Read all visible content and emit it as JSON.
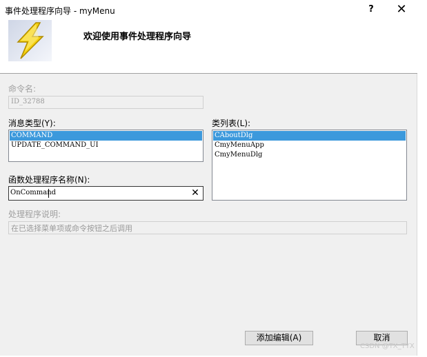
{
  "window": {
    "title": "事件处理程序向导 - myMenu",
    "help_label": "?",
    "close_label": "✕"
  },
  "banner": {
    "title": "欢迎使用事件处理程序向导",
    "icon": "lightning-icon",
    "accent": "#f2c200"
  },
  "command": {
    "label": "命令名:",
    "value": "ID_32788"
  },
  "message_type": {
    "label": "消息类型(Y):",
    "items": [
      "COMMAND",
      "UPDATE_COMMAND_UI"
    ],
    "selected": 0
  },
  "class_list": {
    "label": "类列表(L):",
    "items": [
      "CAboutDlg",
      "CmyMenuApp",
      "CmyMenuDlg"
    ],
    "selected": 0
  },
  "handler_name": {
    "label": "函数处理程序名称(N):",
    "value": "OnCommand",
    "clear_icon": "clear-icon"
  },
  "description": {
    "label": "处理程序说明:",
    "value": "在已选择菜单项或命令按钮之后调用"
  },
  "buttons": {
    "add_edit": "添加编辑(A)",
    "cancel": "取消"
  },
  "watermark": "CSDN @TX_TYX",
  "colors": {
    "selection": "#3c99dc",
    "dialog_bg": "#f0f0f0"
  }
}
